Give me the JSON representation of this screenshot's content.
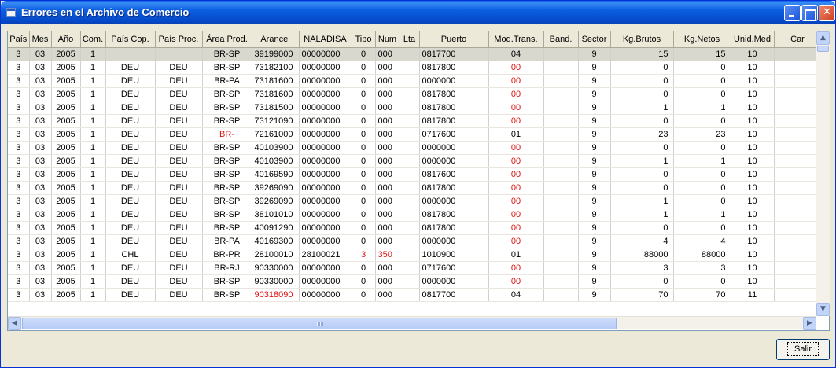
{
  "window": {
    "title": "Errores en el Archivo de Comercio",
    "minimize_label": "",
    "maximize_label": "",
    "close_label": "✕"
  },
  "colors": {
    "error_text": "#e01010",
    "titlebar": "#0b5fe0"
  },
  "grid": {
    "columns": [
      "País",
      "Mes",
      "Año",
      "Com.",
      "País Cop.",
      "País Proc.",
      "Área Prod.",
      "Arancel",
      "NALADISA",
      "Tipo",
      "Num",
      "Lta",
      "Puerto",
      "Mod.Trans.",
      "Band.",
      "Sector",
      "Kg.Brutos",
      "Kg.Netos",
      "Unid.Med",
      "Car"
    ],
    "rows": [
      [
        "3",
        "03",
        "2005",
        "1",
        "",
        "",
        "BR-SP",
        "39199000",
        "00000000",
        "0",
        "000",
        "",
        "0817700",
        "04",
        "",
        "9",
        "15",
        "15",
        "10",
        ""
      ],
      [
        "3",
        "03",
        "2005",
        "1",
        "DEU",
        "DEU",
        "BR-SP",
        "73182100",
        "00000000",
        "0",
        "000",
        "",
        "0817800",
        "00",
        "",
        "9",
        "0",
        "0",
        "10",
        ""
      ],
      [
        "3",
        "03",
        "2005",
        "1",
        "DEU",
        "DEU",
        "BR-PA",
        "73181600",
        "00000000",
        "0",
        "000",
        "",
        "0000000",
        "00",
        "",
        "9",
        "0",
        "0",
        "10",
        ""
      ],
      [
        "3",
        "03",
        "2005",
        "1",
        "DEU",
        "DEU",
        "BR-SP",
        "73181600",
        "00000000",
        "0",
        "000",
        "",
        "0817800",
        "00",
        "",
        "9",
        "0",
        "0",
        "10",
        ""
      ],
      [
        "3",
        "03",
        "2005",
        "1",
        "DEU",
        "DEU",
        "BR-SP",
        "73181500",
        "00000000",
        "0",
        "000",
        "",
        "0817800",
        "00",
        "",
        "9",
        "1",
        "1",
        "10",
        ""
      ],
      [
        "3",
        "03",
        "2005",
        "1",
        "DEU",
        "DEU",
        "BR-SP",
        "73121090",
        "00000000",
        "0",
        "000",
        "",
        "0817800",
        "00",
        "",
        "9",
        "0",
        "0",
        "10",
        ""
      ],
      [
        "3",
        "03",
        "2005",
        "1",
        "DEU",
        "DEU",
        "BR-",
        "72161000",
        "00000000",
        "0",
        "000",
        "",
        "0717600",
        "01",
        "",
        "9",
        "23",
        "23",
        "10",
        ""
      ],
      [
        "3",
        "03",
        "2005",
        "1",
        "DEU",
        "DEU",
        "BR-SP",
        "40103900",
        "00000000",
        "0",
        "000",
        "",
        "0000000",
        "00",
        "",
        "9",
        "0",
        "0",
        "10",
        ""
      ],
      [
        "3",
        "03",
        "2005",
        "1",
        "DEU",
        "DEU",
        "BR-SP",
        "40103900",
        "00000000",
        "0",
        "000",
        "",
        "0000000",
        "00",
        "",
        "9",
        "1",
        "1",
        "10",
        ""
      ],
      [
        "3",
        "03",
        "2005",
        "1",
        "DEU",
        "DEU",
        "BR-SP",
        "40169590",
        "00000000",
        "0",
        "000",
        "",
        "0817600",
        "00",
        "",
        "9",
        "0",
        "0",
        "10",
        ""
      ],
      [
        "3",
        "03",
        "2005",
        "1",
        "DEU",
        "DEU",
        "BR-SP",
        "39269090",
        "00000000",
        "0",
        "000",
        "",
        "0817800",
        "00",
        "",
        "9",
        "0",
        "0",
        "10",
        ""
      ],
      [
        "3",
        "03",
        "2005",
        "1",
        "DEU",
        "DEU",
        "BR-SP",
        "39269090",
        "00000000",
        "0",
        "000",
        "",
        "0000000",
        "00",
        "",
        "9",
        "1",
        "0",
        "10",
        ""
      ],
      [
        "3",
        "03",
        "2005",
        "1",
        "DEU",
        "DEU",
        "BR-SP",
        "38101010",
        "00000000",
        "0",
        "000",
        "",
        "0817800",
        "00",
        "",
        "9",
        "1",
        "1",
        "10",
        ""
      ],
      [
        "3",
        "03",
        "2005",
        "1",
        "DEU",
        "DEU",
        "BR-SP",
        "40091290",
        "00000000",
        "0",
        "000",
        "",
        "0817800",
        "00",
        "",
        "9",
        "0",
        "0",
        "10",
        ""
      ],
      [
        "3",
        "03",
        "2005",
        "1",
        "DEU",
        "DEU",
        "BR-PA",
        "40169300",
        "00000000",
        "0",
        "000",
        "",
        "0000000",
        "00",
        "",
        "9",
        "4",
        "4",
        "10",
        ""
      ],
      [
        "3",
        "03",
        "2005",
        "1",
        "CHL",
        "DEU",
        "BR-PR",
        "28100010",
        "28100021",
        "3",
        "350",
        "",
        "1010900",
        "01",
        "",
        "9",
        "88000",
        "88000",
        "10",
        ""
      ],
      [
        "3",
        "03",
        "2005",
        "1",
        "DEU",
        "DEU",
        "BR-RJ",
        "90330000",
        "00000000",
        "0",
        "000",
        "",
        "0717600",
        "00",
        "",
        "9",
        "3",
        "3",
        "10",
        ""
      ],
      [
        "3",
        "03",
        "2005",
        "1",
        "DEU",
        "DEU",
        "BR-SP",
        "90330000",
        "00000000",
        "0",
        "000",
        "",
        "0000000",
        "00",
        "",
        "9",
        "0",
        "0",
        "10",
        ""
      ],
      [
        "3",
        "03",
        "2005",
        "1",
        "DEU",
        "DEU",
        "BR-SP",
        "90318090",
        "00000000",
        "0",
        "000",
        "",
        "0817700",
        "04",
        "",
        "9",
        "70",
        "70",
        "11",
        ""
      ]
    ],
    "error_cells": [
      [
        1,
        13
      ],
      [
        2,
        13
      ],
      [
        3,
        13
      ],
      [
        4,
        13
      ],
      [
        5,
        13
      ],
      [
        6,
        6
      ],
      [
        7,
        13
      ],
      [
        8,
        13
      ],
      [
        9,
        13
      ],
      [
        10,
        13
      ],
      [
        11,
        13
      ],
      [
        12,
        13
      ],
      [
        13,
        13
      ],
      [
        14,
        13
      ],
      [
        15,
        9
      ],
      [
        15,
        10
      ],
      [
        16,
        13
      ],
      [
        17,
        13
      ],
      [
        18,
        7
      ]
    ]
  },
  "buttons": {
    "salir": "Salir"
  }
}
